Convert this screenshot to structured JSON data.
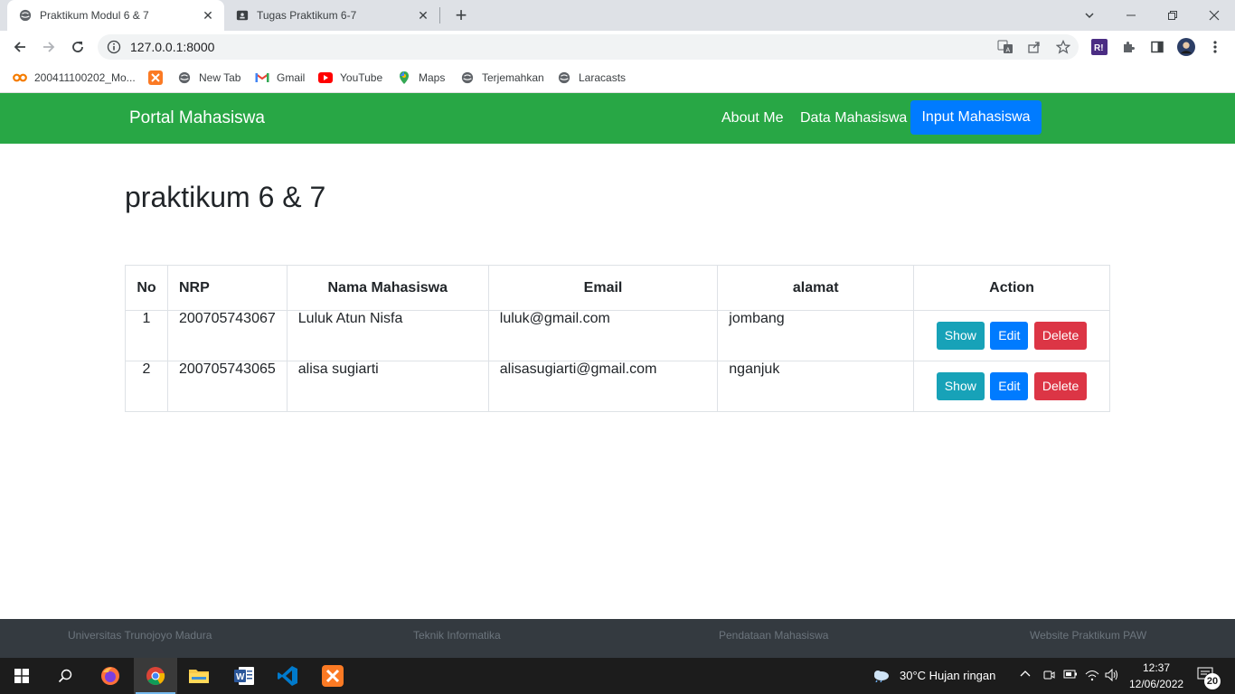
{
  "browser": {
    "tabs": [
      {
        "title": "Praktikum Modul 6 & 7",
        "active": true
      },
      {
        "title": "Tugas Praktikum 6-7",
        "active": false
      }
    ],
    "url": "127.0.0.1:8000",
    "bookmarks": [
      {
        "label": "200411100202_Mo...",
        "icon": "co-icon"
      },
      {
        "label": "",
        "icon": "xampp-icon"
      },
      {
        "label": "New Tab",
        "icon": "globe-icon"
      },
      {
        "label": "Gmail",
        "icon": "gmail-icon"
      },
      {
        "label": "YouTube",
        "icon": "youtube-icon"
      },
      {
        "label": "Maps",
        "icon": "maps-icon"
      },
      {
        "label": "Terjemahkan",
        "icon": "globe-icon"
      },
      {
        "label": "Laracasts",
        "icon": "globe-icon"
      }
    ]
  },
  "site": {
    "brand": "Portal Mahasiswa",
    "nav": {
      "about": "About Me",
      "data": "Data Mahasiswa",
      "input": "Input Mahasiswa"
    },
    "page_title": "praktikum 6 & 7",
    "table": {
      "headers": {
        "no": "No",
        "nrp": "NRP",
        "nama": "Nama Mahasiswa",
        "email": "Email",
        "alamat": "alamat",
        "action": "Action"
      },
      "rows": [
        {
          "no": "1",
          "nrp": "200705743067",
          "nama": "Luluk Atun Nisfa",
          "email": "luluk@gmail.com",
          "alamat": "jombang"
        },
        {
          "no": "2",
          "nrp": "200705743065",
          "nama": "alisa sugiarti",
          "email": "alisasugiarti@gmail.com",
          "alamat": "nganjuk"
        }
      ],
      "buttons": {
        "show": "Show",
        "edit": "Edit",
        "delete": "Delete"
      }
    },
    "footer": [
      "Universitas Trunojoyo Madura",
      "Teknik Informatika",
      "Pendataan Mahasiswa",
      "Website Praktikum PAW"
    ]
  },
  "taskbar": {
    "weather": "30°C  Hujan ringan",
    "time": "12:37",
    "date": "12/06/2022",
    "notifications": "20"
  },
  "colors": {
    "navbar": "#28a745",
    "primary": "#007bff",
    "info": "#17a2b8",
    "danger": "#dc3545",
    "footer": "#343a40"
  }
}
